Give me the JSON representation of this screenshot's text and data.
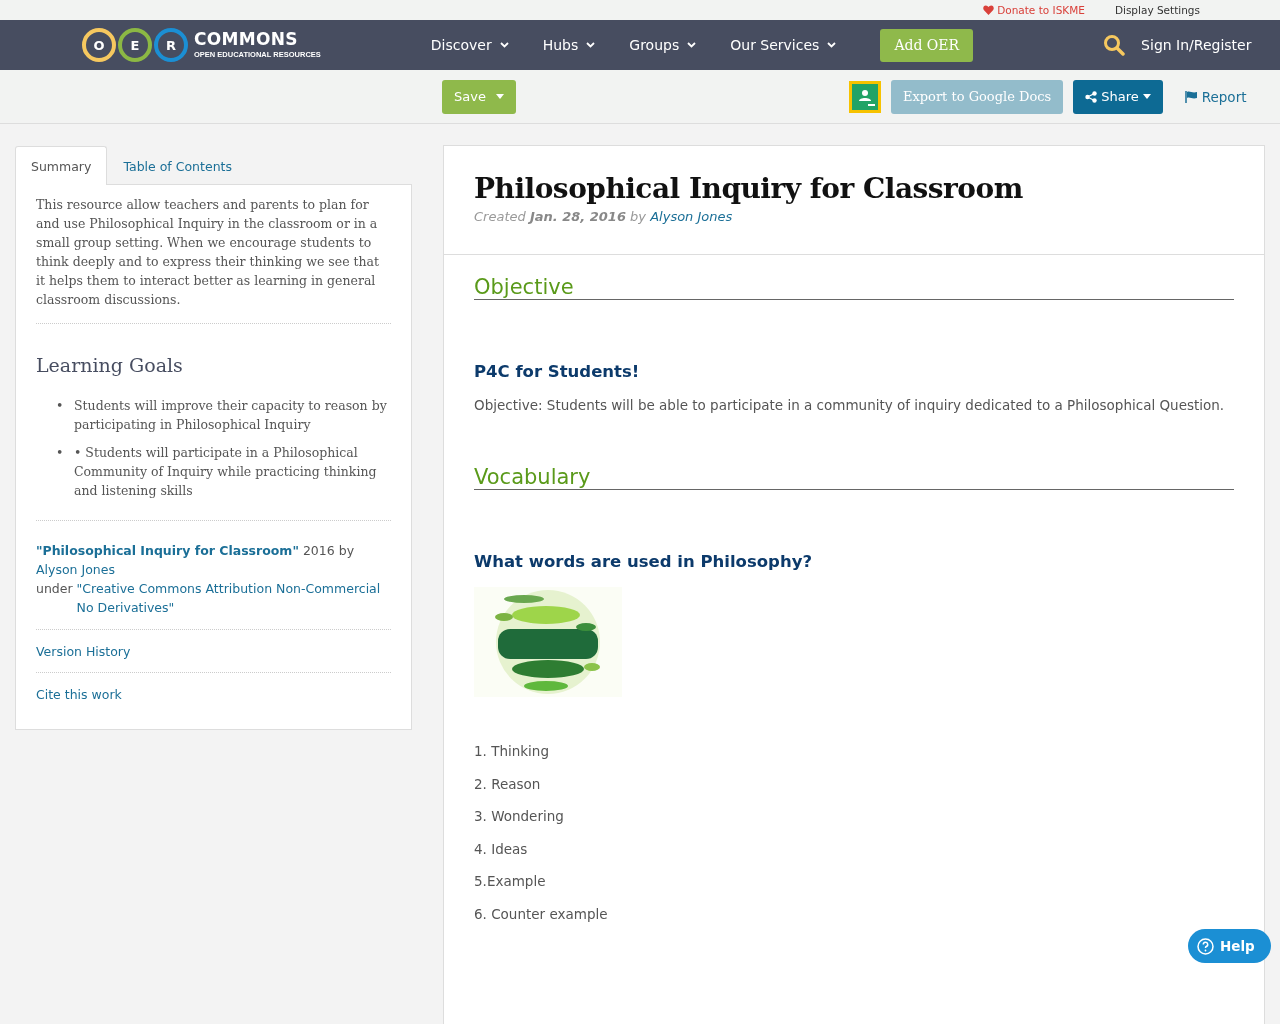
{
  "top_bar": {
    "donate": "Donate to ISKME",
    "display_settings": "Display Settings"
  },
  "logo": {
    "letters": [
      {
        "char": "O",
        "color": "#f6c85f"
      },
      {
        "char": "E",
        "color": "#8cb844"
      },
      {
        "char": "R",
        "color": "#1b8fd4"
      }
    ],
    "name": "COMMONS",
    "tagline": "OPEN EDUCATIONAL RESOURCES"
  },
  "nav": {
    "items": [
      {
        "label": "Discover"
      },
      {
        "label": "Hubs"
      },
      {
        "label": "Groups"
      },
      {
        "label": "Our Services"
      }
    ],
    "add_button": "Add OER",
    "sign_in": "Sign In/Register"
  },
  "toolbar": {
    "save": "Save",
    "export": "Export to Google Docs",
    "share": "Share",
    "report": "Report"
  },
  "sidebar": {
    "tabs": [
      {
        "label": "Summary",
        "selected": true
      },
      {
        "label": "Table of Contents",
        "selected": false
      }
    ],
    "summary": "This resource allow teachers and parents to plan for and use Philosophical Inquiry in the classroom or in a small group setting. When we encourage students to think deeply and to express their thinking we see that it helps them to interact better as learning in general classroom discussions.",
    "goals_title": "Learning Goals",
    "goals": [
      {
        "marker": "•",
        "text": "Students will improve their capacity to reason by participating in Philosophical Inquiry"
      },
      {
        "marker": "•",
        "text": "• Students will participate in a Philosophical Community of Inquiry while practicing thinking and listening skills"
      }
    ],
    "attribution": {
      "title": "\"Philosophical Inquiry for Classroom\"",
      "year": "2016 by",
      "author": "Alyson Jones",
      "under": "under",
      "license": "\"Creative Commons Attribution Non-Commercial No Derivatives\""
    },
    "links": [
      "Version History",
      "Cite this work"
    ]
  },
  "resource": {
    "title": "Philosophical Inquiry for Classroom",
    "created_label": "Created",
    "date": "Jan. 28, 2016",
    "by": "by",
    "author": "Alyson Jones",
    "sections": [
      {
        "heading": "Objective",
        "subheading": "P4C for Students!",
        "body": "Objective: Students will be able to participate in a community of inquiry dedicated to a Philosophical Question."
      },
      {
        "heading": "Vocabulary",
        "subheading": "What words are used in Philosophy?",
        "list": [
          "1. Thinking",
          "2. Reason",
          "3. Wondering",
          "4. Ideas",
          "5.Example",
          "6. Counter example"
        ]
      }
    ]
  },
  "help": "Help"
}
